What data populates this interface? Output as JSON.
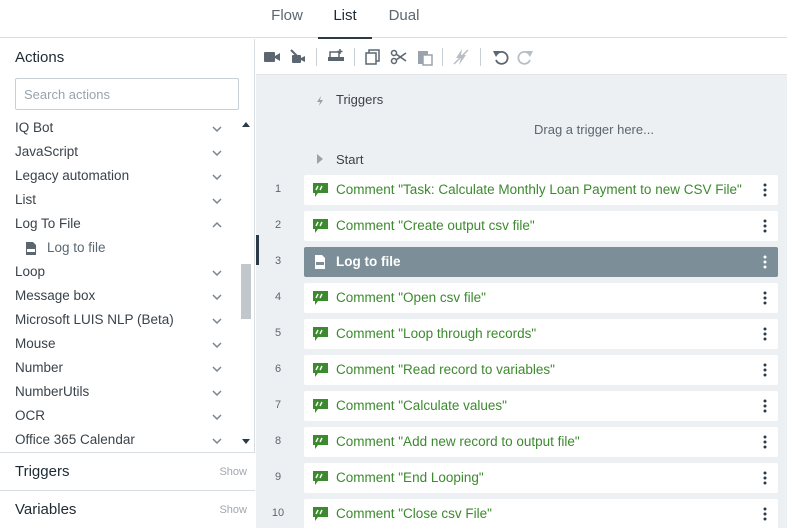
{
  "tabs": {
    "flow": "Flow",
    "list": "List",
    "dual": "Dual"
  },
  "sidebar": {
    "title": "Actions",
    "search_placeholder": "Search actions",
    "items": [
      {
        "label": "IQ Bot",
        "expanded": false
      },
      {
        "label": "JavaScript",
        "expanded": false
      },
      {
        "label": "Legacy automation",
        "expanded": false
      },
      {
        "label": "List",
        "expanded": false
      },
      {
        "label": "Log To File",
        "expanded": true
      },
      {
        "label": "Log to file",
        "sub": true
      },
      {
        "label": "Loop",
        "expanded": false
      },
      {
        "label": "Message box",
        "expanded": false
      },
      {
        "label": "Microsoft LUIS NLP (Beta)",
        "expanded": false
      },
      {
        "label": "Mouse",
        "expanded": false
      },
      {
        "label": "Number",
        "expanded": false
      },
      {
        "label": "NumberUtils",
        "expanded": false
      },
      {
        "label": "OCR",
        "expanded": false
      },
      {
        "label": "Office 365 Calendar",
        "expanded": false
      }
    ],
    "triggers": {
      "label": "Triggers",
      "show": "Show"
    },
    "variables": {
      "label": "Variables",
      "show": "Show"
    }
  },
  "toolbar": {
    "buttons": [
      "record-icon",
      "record-settings-icon",
      "add-step-icon",
      "copy-icon",
      "cut-icon",
      "paste-icon",
      "disable-icon",
      "undo-icon",
      "redo-icon"
    ]
  },
  "editor": {
    "triggers_label": "Triggers",
    "drop_hint": "Drag a trigger here...",
    "start_label": "Start",
    "steps": [
      {
        "num": "1",
        "text": "Comment \"Task: Calculate Monthly Loan Payment to new CSV File\"",
        "type": "comment"
      },
      {
        "num": "2",
        "text": "Comment \"Create output csv file\"",
        "type": "comment"
      },
      {
        "num": "3",
        "text": "Log to file",
        "type": "log",
        "selected": true
      },
      {
        "num": "4",
        "text": "Comment \"Open csv file\"",
        "type": "comment"
      },
      {
        "num": "5",
        "text": "Comment \"Loop through records\"",
        "type": "comment"
      },
      {
        "num": "6",
        "text": "Comment \"Read record to variables\"",
        "type": "comment"
      },
      {
        "num": "7",
        "text": "Comment \"Calculate values\"",
        "type": "comment"
      },
      {
        "num": "8",
        "text": "Comment \"Add new record to output file\"",
        "type": "comment"
      },
      {
        "num": "9",
        "text": "Comment \"End Looping\"",
        "type": "comment"
      },
      {
        "num": "10",
        "text": "Comment \"Close csv File\"",
        "type": "comment"
      }
    ]
  },
  "colors": {
    "comment_green": "#3c8a2e",
    "selected_row": "#7c8e98"
  }
}
